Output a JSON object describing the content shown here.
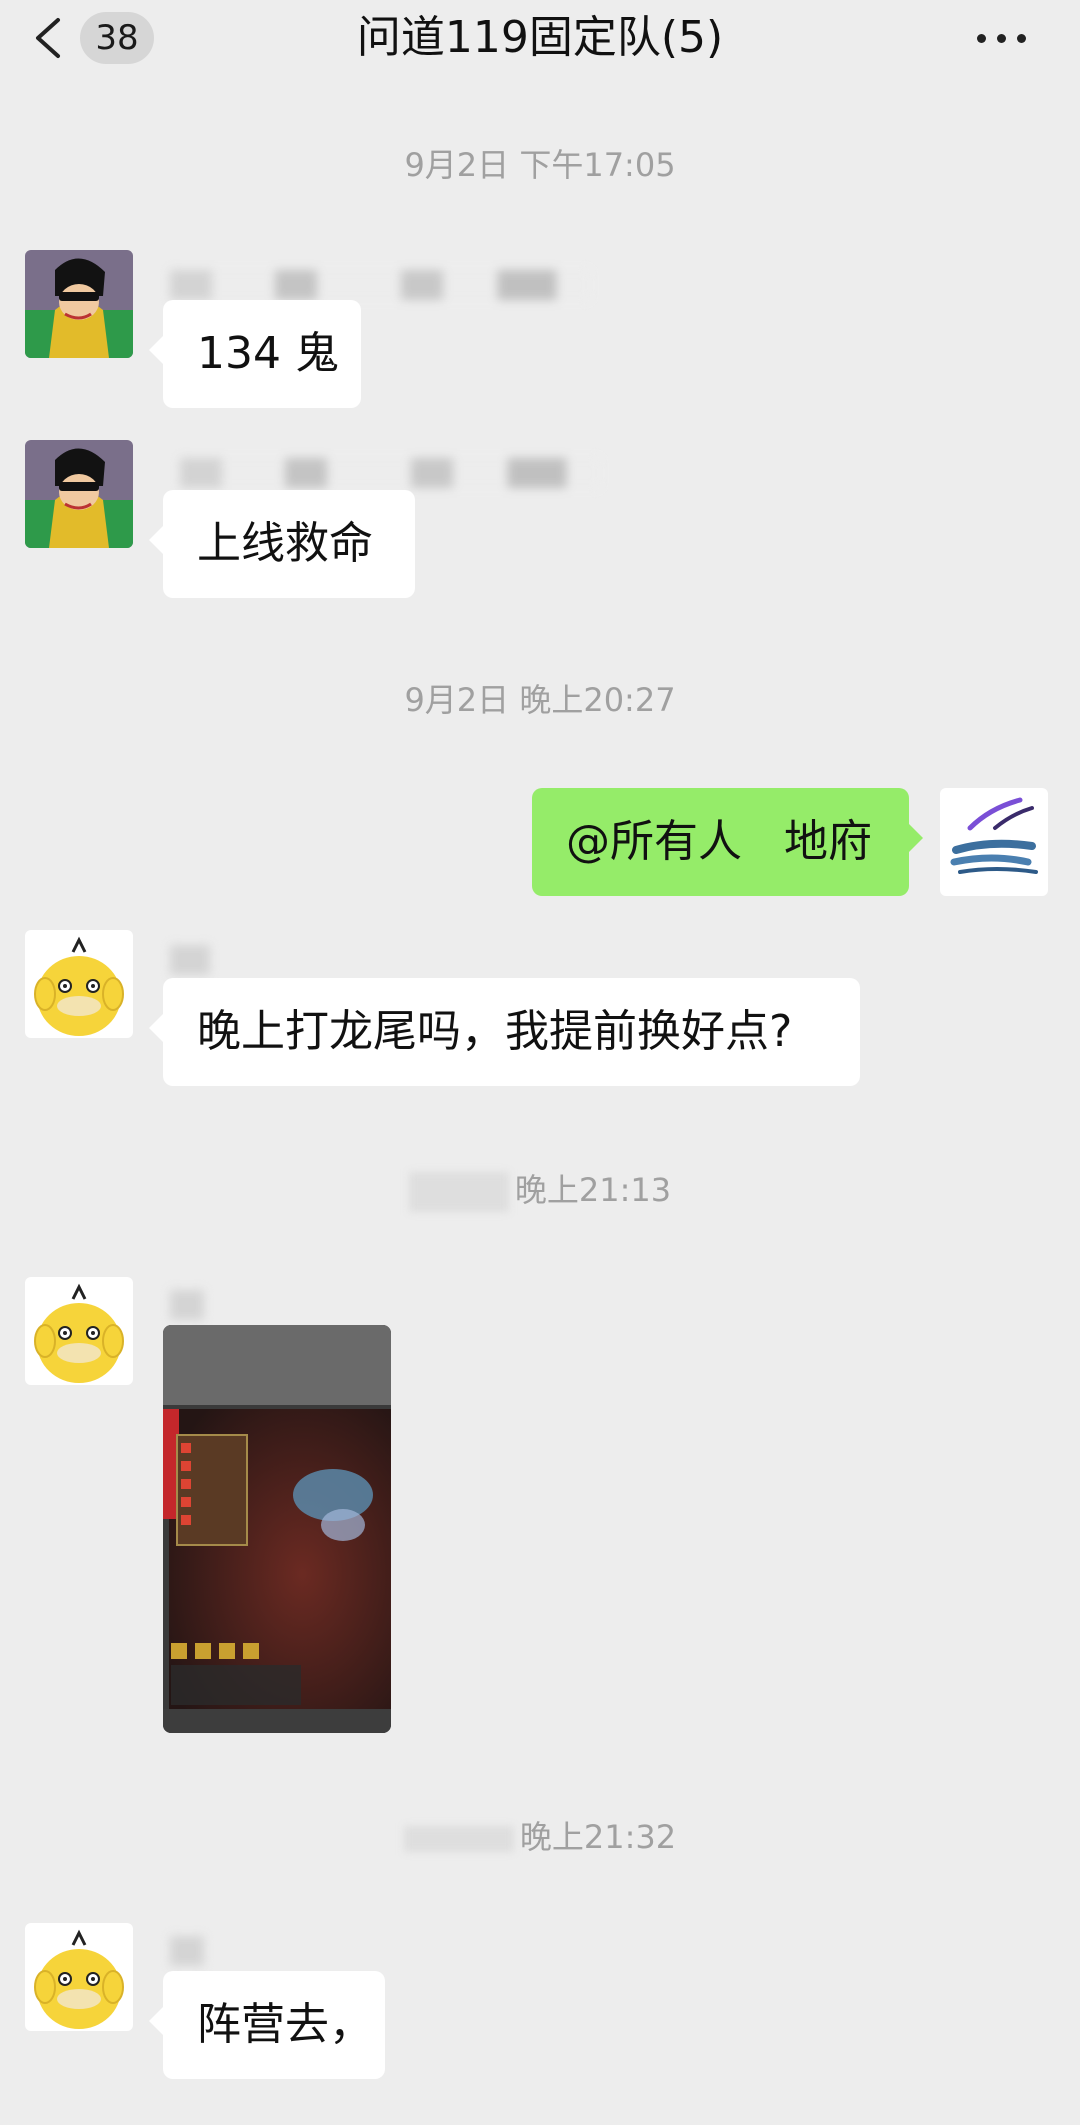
{
  "header": {
    "back_icon": "chevron-left-icon",
    "unread_count": "38",
    "title": "问道119固定队(5)",
    "more_icon": "ellipsis-icon"
  },
  "timestamps": {
    "t1": "9月2日 下午17:05",
    "t2": "9月2日 晚上20:27",
    "t3": "晚上21:13",
    "t4": "晚上21:32"
  },
  "messages": [
    {
      "sender": "left",
      "avatar_icon": "cartoon-man-avatar-icon",
      "text": "134 鬼"
    },
    {
      "sender": "left",
      "avatar_icon": "cartoon-man-avatar-icon",
      "text": "上线救命"
    },
    {
      "sender": "right",
      "avatar_icon": "brush-stroke-avatar-icon",
      "text": "@所有人   地府"
    },
    {
      "sender": "left",
      "avatar_icon": "yellow-duck-avatar-icon",
      "text": "晚上打龙尾吗，我提前换好点?"
    },
    {
      "sender": "left",
      "avatar_icon": "yellow-duck-avatar-icon",
      "type": "image",
      "image_icon": "game-screenshot-photo"
    },
    {
      "sender": "left",
      "avatar_icon": "yellow-duck-avatar-icon",
      "text": "阵营去，"
    }
  ],
  "colors": {
    "background": "#ededed",
    "bubble_left": "#ffffff",
    "bubble_right": "#95ec69",
    "timestamp": "#a0a0a0"
  }
}
